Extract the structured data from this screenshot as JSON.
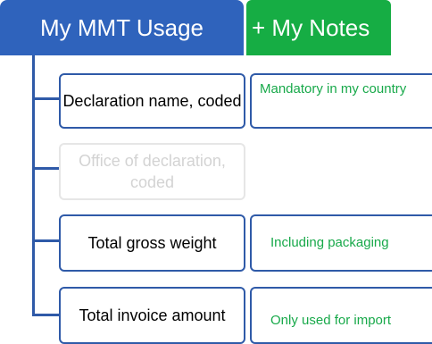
{
  "header": {
    "usage_title": "My MMT Usage",
    "notes_title": "+ My Notes"
  },
  "items": [
    {
      "label": "Declaration name, coded",
      "note": "Mandatory in my country",
      "active": true
    },
    {
      "label": "Office of declaration, coded",
      "note": "",
      "active": false
    },
    {
      "label": "Total gross weight",
      "note": "Including packaging",
      "active": true
    },
    {
      "label": "Total invoice amount",
      "note": "Only used for import",
      "active": true
    }
  ],
  "colors": {
    "usage_header": "#2f63bc",
    "notes_header": "#16ad44",
    "border": "#2f5aa8",
    "note_text": "#18a94a",
    "faded_text": "#d3d3d3"
  }
}
